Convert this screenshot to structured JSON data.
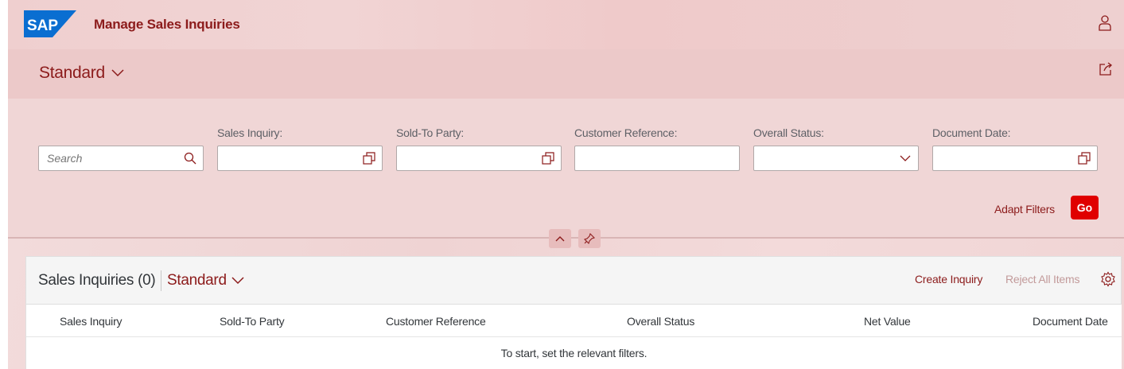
{
  "shell": {
    "logo_text": "SAP",
    "app_title": "Manage Sales Inquiries",
    "user_icon": "person-icon",
    "brand_color": "#8c1b1b"
  },
  "header": {
    "variant_label": "Standard",
    "share_icon": "share-icon"
  },
  "filters": {
    "search_placeholder": "Search",
    "fields": [
      {
        "label": "Sales Inquiry:",
        "value": "",
        "icon": "value-help-icon"
      },
      {
        "label": "Sold-To Party:",
        "value": "",
        "icon": "value-help-icon"
      },
      {
        "label": "Customer Reference:",
        "value": ""
      },
      {
        "label": "Overall Status:",
        "value": "",
        "icon": "chevron-down-icon"
      },
      {
        "label": "Document Date:",
        "value": "",
        "icon": "value-help-icon"
      }
    ],
    "adapt_label": "Adapt Filters",
    "go_label": "Go",
    "go_color": "#e00000"
  },
  "table": {
    "title": "Sales Inquiries (0)",
    "variant_label": "Standard",
    "create_label": "Create Inquiry",
    "reject_label": "Reject All Items",
    "columns": [
      "Sales Inquiry",
      "Sold-To Party",
      "Customer Reference",
      "Overall Status",
      "Net Value",
      "Document Date"
    ],
    "empty_text": "To start, set the relevant filters."
  }
}
